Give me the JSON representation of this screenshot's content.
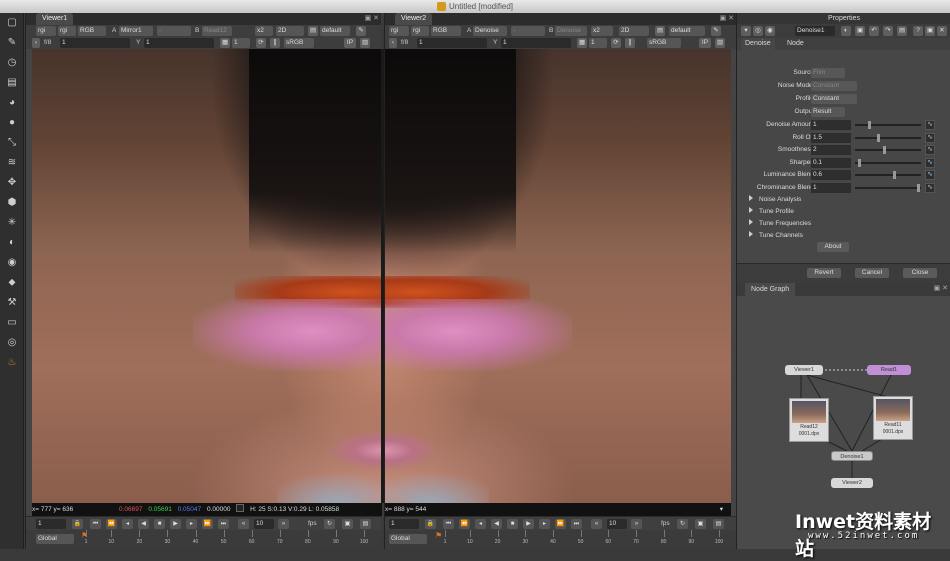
{
  "window": {
    "title": "Untitled [modified]"
  },
  "toolbar": {
    "tools": [
      "viewer-tool",
      "paint-tool",
      "time-tool",
      "channel-tool",
      "color-tool",
      "filter-tool",
      "keyer-tool",
      "merge-tool",
      "transform-tool",
      "3d-tool",
      "particles-tool",
      "deep-tool",
      "views-tool",
      "metadata-tool",
      "toolsets-tool",
      "other-tool",
      "furnace-tool",
      "ocula-tool"
    ]
  },
  "viewer1": {
    "tab": "Viewer1",
    "row1": {
      "channels": "rgi",
      "channels2": "rgi",
      "colorspace": "RGB",
      "input_a_label": "A",
      "input_a": "Mirror1",
      "wipe": "-",
      "input_b_label": "B",
      "input_b": "Read12",
      "zoom": "x2",
      "mode": "2D",
      "lut": "default"
    },
    "row2": {
      "fstop": "f/8",
      "gain": "1",
      "gamma_label": "Y",
      "gamma": "1",
      "proxy": "1",
      "display": "sRGB",
      "ip": "IP"
    },
    "info": {
      "coords": "x= 777 y= 636",
      "r": "0.06697",
      "g": "0.05691",
      "b": "0.05047",
      "a": "0.00000",
      "hsvl": "H: 25 S:0.13 V:0.29  L: 0.05858"
    },
    "timeline": {
      "frame": "1",
      "increment": "10",
      "fps": "fps"
    },
    "ruler": {
      "scope": "Global",
      "ticks": [
        "1",
        "10",
        "20",
        "30",
        "40",
        "50",
        "60",
        "70",
        "80",
        "90",
        "100"
      ]
    }
  },
  "viewer2": {
    "tab": "Viewer2",
    "row1": {
      "channels": "rgi",
      "channels2": "rgi",
      "colorspace": "RGB",
      "input_a_label": "A",
      "input_a": "Denoise",
      "wipe": "-",
      "input_b_label": "B",
      "input_b": "Denoise",
      "zoom": "x2",
      "mode": "2D",
      "lut": "default"
    },
    "row2": {
      "fstop": "f/8",
      "gain": "1",
      "gamma_label": "Y",
      "gamma": "1",
      "proxy": "1",
      "display": "sRGB",
      "ip": "IP"
    },
    "info": {
      "coords": "x= 888 y= 544"
    },
    "timeline": {
      "frame": "1",
      "increment": "10",
      "fps": "fps"
    },
    "ruler": {
      "scope": "Global",
      "ticks": [
        "1",
        "10",
        "20",
        "30",
        "40",
        "50",
        "60",
        "70",
        "80",
        "90",
        "100"
      ]
    }
  },
  "properties": {
    "title": "Properties",
    "node_name": "Denoise1",
    "tabs": [
      "Denoise",
      "Node"
    ],
    "source_label": "Source",
    "source": "Film",
    "noise_model_label": "Noise Model",
    "noise_model": "Constant",
    "profile_label": "Profile",
    "profile": "Constant",
    "output_label": "Output",
    "output": "Result",
    "params": [
      {
        "label": "Denoise Amount",
        "value": "1",
        "level": 0.2
      },
      {
        "label": "Roll Off",
        "value": "1.5",
        "level": 0.35
      },
      {
        "label": "Smoothness",
        "value": "2",
        "level": 0.45
      },
      {
        "label": "Sharpen",
        "value": "0.1",
        "level": 0.05
      },
      {
        "label": "Luminance Blend",
        "value": "0.6",
        "level": 0.6
      },
      {
        "label": "Chrominance Blend",
        "value": "1",
        "level": 0.98
      }
    ],
    "sections": [
      "Noise Analysis",
      "Tune Profile",
      "Tune Frequencies",
      "Tune Channels"
    ],
    "about": "About",
    "revert": "Revert",
    "cancel": "Cancel",
    "close": "Close"
  },
  "nodegraph": {
    "title": "Node Graph",
    "nodes": {
      "viewer1": "Viewer1",
      "read_top": "Read1",
      "read12": "Read12",
      "read12_file": "0001.dpx",
      "read11": "Read11",
      "read11_file": "0001.dpx",
      "denoise": "Denoise1",
      "viewer2": "Viewer2"
    }
  },
  "watermark": {
    "text": "Inwet资料素材站",
    "url": "www.52inwet.com"
  },
  "colors": {
    "accent": "#c08fd6",
    "node_viewer": "#d8d8d8",
    "node_read": "#b8b8b8"
  }
}
